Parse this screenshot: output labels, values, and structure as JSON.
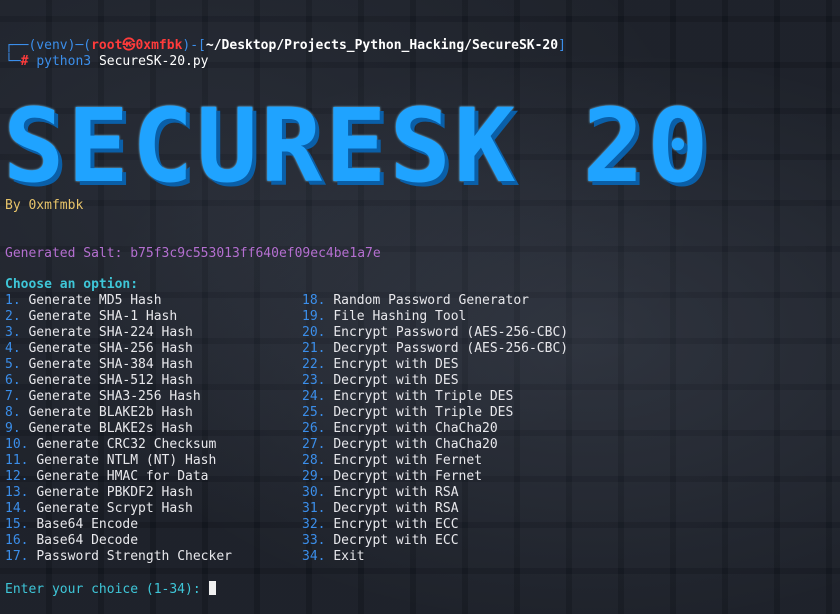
{
  "prompt": {
    "venv": "(venv)",
    "user": "root",
    "skull": "㉿",
    "host": "0xmfbk",
    "path": "~/Desktop/Projects_Python_Hacking/SecureSK-20",
    "hash": "#",
    "cmd_bin": "python3",
    "cmd_arg": "SecureSK-20.py"
  },
  "banner": {
    "title": "SECURESK 20",
    "author": "By 0xmfmbk"
  },
  "salt": {
    "label": "Generated Salt:",
    "value": "b75f3c9c553013ff640ef09ec4be1a7e"
  },
  "menu": {
    "heading": "Choose an option:",
    "left": [
      {
        "num": "1.",
        "label": "Generate MD5 Hash"
      },
      {
        "num": "2.",
        "label": "Generate SHA-1 Hash"
      },
      {
        "num": "3.",
        "label": "Generate SHA-224 Hash"
      },
      {
        "num": "4.",
        "label": "Generate SHA-256 Hash"
      },
      {
        "num": "5.",
        "label": "Generate SHA-384 Hash"
      },
      {
        "num": "6.",
        "label": "Generate SHA-512 Hash"
      },
      {
        "num": "7.",
        "label": "Generate SHA3-256 Hash"
      },
      {
        "num": "8.",
        "label": "Generate BLAKE2b Hash"
      },
      {
        "num": "9.",
        "label": "Generate BLAKE2s Hash"
      },
      {
        "num": "10.",
        "label": "Generate CRC32 Checksum"
      },
      {
        "num": "11.",
        "label": "Generate NTLM (NT) Hash"
      },
      {
        "num": "12.",
        "label": "Generate HMAC for Data"
      },
      {
        "num": "13.",
        "label": "Generate PBKDF2 Hash"
      },
      {
        "num": "14.",
        "label": "Generate Scrypt Hash"
      },
      {
        "num": "15.",
        "label": "Base64 Encode"
      },
      {
        "num": "16.",
        "label": "Base64 Decode"
      },
      {
        "num": "17.",
        "label": "Password Strength Checker"
      }
    ],
    "right": [
      {
        "num": "18.",
        "label": "Random Password Generator"
      },
      {
        "num": "19.",
        "label": "File Hashing Tool"
      },
      {
        "num": "20.",
        "label": "Encrypt Password (AES-256-CBC)"
      },
      {
        "num": "21.",
        "label": "Decrypt Password (AES-256-CBC)"
      },
      {
        "num": "22.",
        "label": "Encrypt with DES"
      },
      {
        "num": "23.",
        "label": "Decrypt with DES"
      },
      {
        "num": "24.",
        "label": "Encrypt with Triple DES"
      },
      {
        "num": "25.",
        "label": "Decrypt with Triple DES"
      },
      {
        "num": "26.",
        "label": "Encrypt with ChaCha20"
      },
      {
        "num": "27.",
        "label": "Decrypt with ChaCha20"
      },
      {
        "num": "28.",
        "label": "Encrypt with Fernet"
      },
      {
        "num": "29.",
        "label": "Decrypt with Fernet"
      },
      {
        "num": "30.",
        "label": "Encrypt with RSA"
      },
      {
        "num": "31.",
        "label": "Decrypt with RSA"
      },
      {
        "num": "32.",
        "label": "Encrypt with ECC"
      },
      {
        "num": "33.",
        "label": "Decrypt with ECC"
      },
      {
        "num": "34.",
        "label": "Exit"
      }
    ]
  },
  "input": {
    "prompt": "Enter your choice (1-34):",
    "value": ""
  },
  "colors": {
    "background": "#161a24",
    "banner": "#1fa3ff",
    "prompt_blue": "#3b8eea",
    "user_red": "#ff3b3b",
    "salt_purple": "#b46fd0",
    "heading_cyan": "#3ec6d8"
  }
}
